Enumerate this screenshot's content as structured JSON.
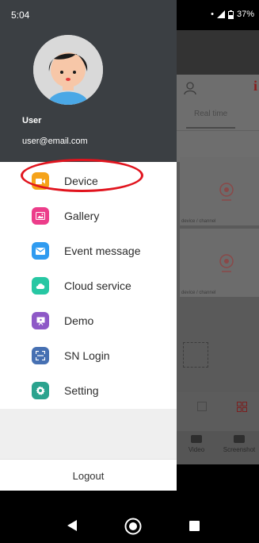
{
  "status_bar": {
    "time": "5:04",
    "battery": "37%",
    "icons": [
      "dot-icon",
      "signal-icon",
      "battery-icon"
    ]
  },
  "drawer": {
    "user": {
      "name": "User",
      "email": "user@email.com"
    },
    "menu": [
      {
        "label": "Device",
        "icon": "video-camera-icon",
        "color": "#f5a31a"
      },
      {
        "label": "Gallery",
        "icon": "image-icon",
        "color": "#ec3d8a"
      },
      {
        "label": "Event message",
        "icon": "envelope-icon",
        "color": "#2f9bf0"
      },
      {
        "label": "Cloud service",
        "icon": "cloud-icon",
        "color": "#27c7a3"
      },
      {
        "label": "Demo",
        "icon": "presentation-icon",
        "color": "#8e59c7"
      },
      {
        "label": "SN Login",
        "icon": "scan-icon",
        "color": "#4670b2"
      },
      {
        "label": "Setting",
        "icon": "gear-icon",
        "color": "#2aa38e"
      }
    ],
    "highlighted_item": "Device",
    "highlight_color": "#e1141e",
    "logout_label": "Logout"
  },
  "background_app": {
    "logo": "i",
    "tab_label": "Real time",
    "card_labels": [
      "device / channel",
      "device / channel"
    ],
    "toolbar": [
      "Video",
      "Screenshot"
    ],
    "accent_color": "#8a1e1e"
  },
  "nav_bar": {
    "buttons": [
      "back-icon",
      "home-icon",
      "recents-icon"
    ]
  }
}
